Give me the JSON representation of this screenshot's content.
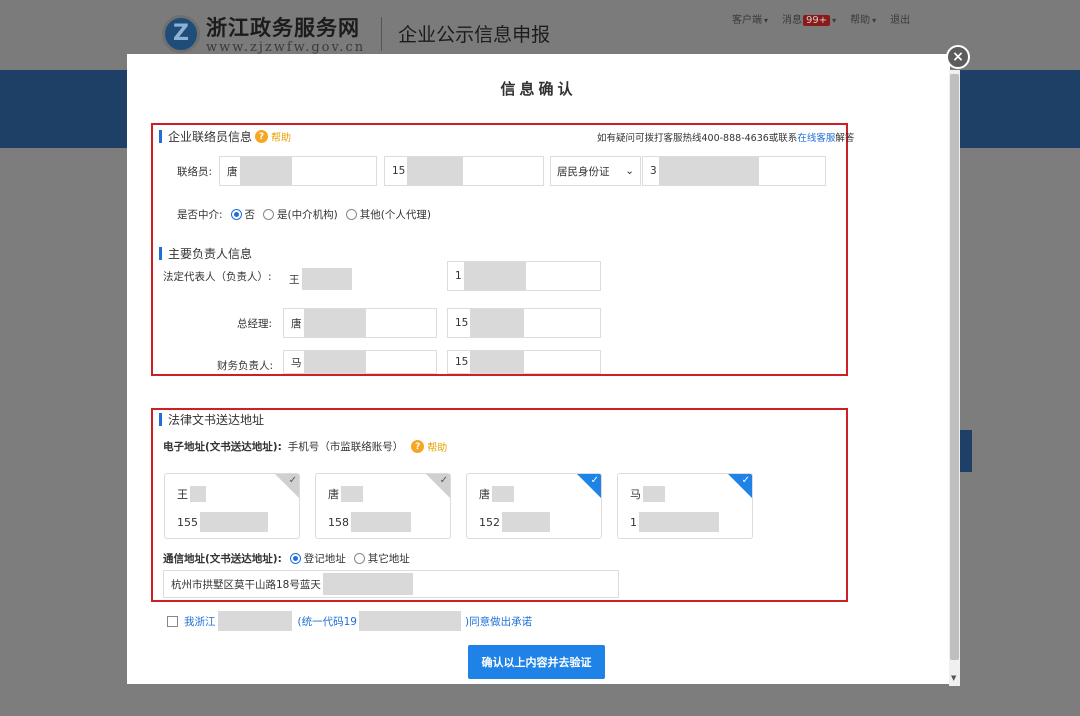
{
  "background": {
    "logo_mark": "Z",
    "logo_name": "浙江政务服务网",
    "logo_url": "www.zjzwfw.gov.cn",
    "subtitle": "企业公示信息申报",
    "links": [
      {
        "label": "客户端",
        "has_arrow": true
      },
      {
        "label": "消息",
        "badge": "99+",
        "has_arrow": true
      },
      {
        "label": "帮助",
        "has_arrow": true
      },
      {
        "label": "退出",
        "has_arrow": false
      }
    ]
  },
  "modal": {
    "title": "信息确认",
    "close_glyph": "×"
  },
  "contact_section": {
    "title": "企业联络员信息",
    "help_label": "帮助",
    "hotline_prefix": "如有疑问可拨打客服热线400-888-4636或联系",
    "hotline_link": "在线客服",
    "hotline_suffix": "解答",
    "contact_label": "联络员:",
    "contact_name": "唐",
    "contact_phone": "15",
    "id_type": "居民身份证",
    "id_number": "3",
    "agent_label": "是否中介:",
    "agent_options": [
      {
        "label": "否",
        "checked": true
      },
      {
        "label": "是(中介机构)",
        "checked": false
      },
      {
        "label": "其他(个人代理)",
        "checked": false
      }
    ]
  },
  "principal_section": {
    "title": "主要负责人信息",
    "rows": [
      {
        "label": "法定代表人（负责人）:",
        "name": "王",
        "phone": "1"
      },
      {
        "label": "总经理:",
        "name": "唐",
        "phone": "15"
      },
      {
        "label": "财务负责人:",
        "name": "马",
        "phone": "15"
      }
    ]
  },
  "legal_section": {
    "title": "法律文书送达地址",
    "email_label": "电子地址(文书送达地址):",
    "email_type": "手机号（市监联络账号）",
    "help_label": "帮助",
    "cards": [
      {
        "name": "王",
        "phone": "155",
        "selected": false
      },
      {
        "name": "唐",
        "phone": "158",
        "selected": false
      },
      {
        "name": "唐",
        "phone": "152",
        "selected": true
      },
      {
        "name": "马",
        "phone": "1",
        "selected": true
      }
    ],
    "postal_label": "通信地址(文书送达地址):",
    "postal_options": [
      {
        "label": "登记地址",
        "checked": true
      },
      {
        "label": "其它地址",
        "checked": false
      }
    ],
    "address": "杭州市拱墅区莫干山路18号蓝天"
  },
  "commitment": {
    "prefix": "我浙江",
    "code_prefix": "(统一代码19",
    "suffix": ")同意做出承诺",
    "checked": false
  },
  "submit_label": "确认以上内容并去验证",
  "colors": {
    "accent": "#1e82e6",
    "highlight_box": "#cc1f26",
    "help": "#f5a623"
  }
}
